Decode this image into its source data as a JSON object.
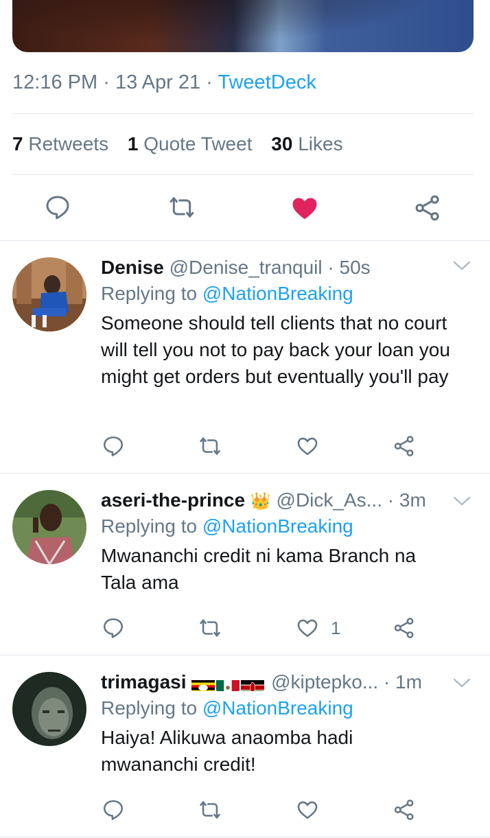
{
  "tweet": {
    "time": "12:16 PM",
    "date": "13 Apr 21",
    "source": "TweetDeck",
    "separator": "·",
    "retweets_count": "7",
    "retweets_label": "Retweets",
    "quotes_count": "1",
    "quotes_label": "Quote Tweet",
    "likes_count": "30",
    "likes_label": "Likes",
    "liked": true
  },
  "colors": {
    "accent": "#1da1f2",
    "muted": "#657786",
    "like": "#e0245e",
    "divider": "#e1e8ed"
  },
  "replies": [
    {
      "name": "Denise",
      "handle": "@Denise_tranquil",
      "time": "50s",
      "replying_prefix": "Replying to",
      "replying_to": "@NationBreaking",
      "text": "Someone should tell clients that no court will tell you not to pay back your loan you might get orders but eventually you'll pay",
      "like_count": ""
    },
    {
      "name": "aseri-the-prince",
      "badge": "👑",
      "handle": "@Dick_As...",
      "time": "3m",
      "replying_prefix": "Replying to",
      "replying_to": "@NationBreaking",
      "text": "Mwananchi credit ni kama Branch na Tala ama",
      "like_count": "1"
    },
    {
      "name": "trimagasi",
      "flags": [
        "uganda-flag",
        "mexico-flag",
        "kenya-flag"
      ],
      "handle": "@kiptepko...",
      "time": "1m",
      "replying_prefix": "Replying to",
      "replying_to": "@NationBreaking",
      "text": "Haiya! Alikuwa anaomba hadi mwananchi credit!",
      "like_count": ""
    }
  ]
}
